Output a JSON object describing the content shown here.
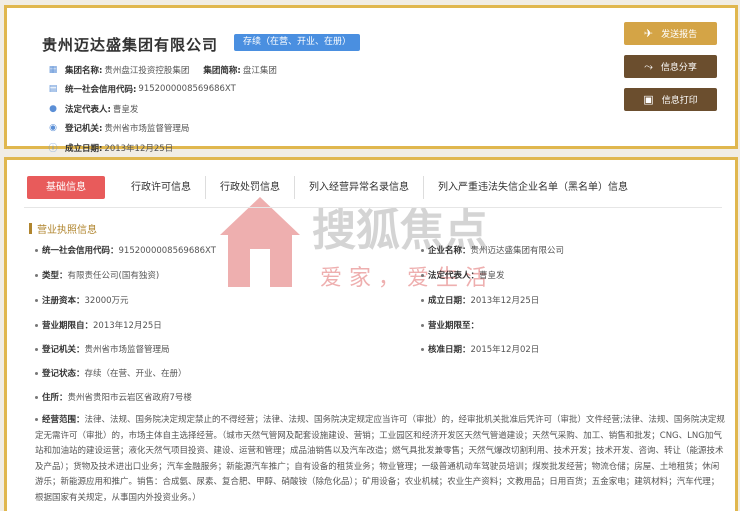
{
  "header": {
    "company_name": "贵州迈达盛集团有限公司",
    "status_tag": "存续（在营、开业、在册）",
    "lines": [
      {
        "icon": "building-icon",
        "label": "集团名称:",
        "value": "贵州盘江投资控股集团",
        "label2": "集团简称:",
        "value2": "盘江集团"
      },
      {
        "icon": "credit-code-icon",
        "label": "统一社会信用代码:",
        "value": "9152000008569686XT"
      },
      {
        "icon": "person-icon",
        "label": "法定代表人:",
        "value": "曹皇发"
      },
      {
        "icon": "location-pin-icon",
        "label": "登记机关:",
        "value": "贵州省市场监督管理局"
      },
      {
        "icon": "info-circle-icon",
        "label": "成立日期:",
        "value": "2013年12月25日"
      }
    ]
  },
  "actions": {
    "report": {
      "label": "发送报告",
      "icon": "send-icon"
    },
    "share": {
      "label": "信息分享",
      "icon": "share-icon"
    },
    "print": {
      "label": "信息打印",
      "icon": "print-icon"
    }
  },
  "tabs": [
    {
      "label": "基础信息",
      "active": true
    },
    {
      "label": "行政许可信息"
    },
    {
      "label": "行政处罚信息"
    },
    {
      "label": "列入经营异常名录信息"
    },
    {
      "label": "列入严重违法失信企业名单（黑名单）信息"
    }
  ],
  "section": {
    "title": "营业执照信息",
    "credit_code_label": "统一社会信用代码：",
    "credit_code": "9152000008569686XT",
    "company_name_label": "企业名称：",
    "company_name": "贵州迈达盛集团有限公司",
    "type_label": "类型：",
    "type": "有限责任公司(国有独资)",
    "legal_rep_label": "法定代表人：",
    "legal_rep": "曹皇发",
    "capital_label": "注册资本：",
    "capital": "32000万元",
    "founded_label": "成立日期：",
    "founded": "2013年12月25日",
    "period_from_label": "营业期限自：",
    "period_from": "2013年12月25日",
    "period_to_label": "营业期限至：",
    "period_to": "",
    "authority_label": "登记机关：",
    "authority": "贵州省市场监督管理局",
    "approval_label": "核准日期：",
    "approval": "2015年12月02日",
    "status_label": "登记状态：",
    "status": "存续（在营、开业、在册）",
    "address_label": "住所：",
    "address": "贵州省贵阳市云岩区省政府7号楼",
    "scope_label": "经营范围：",
    "scope": "法律、法规、国务院决定规定禁止的不得经营；法律、法规、国务院决定规定应当许可（审批）的，经审批机关批准后凭许可（审批）文件经营;法律、法规、国务院决定规定无需许可（审批）的，市场主体自主选择经营。（城市天然气管网及配套设施建设、营销；工业园区和经济开发区天然气管道建设；天然气采购、加工、销售和批发；CNG、LNG加气站和加油站的建设运营；液化天然气项目投资、建设、运营和管理；成品油销售以及汽车改造；燃气具批发兼零售；天然气爆改切割利用、技术开发；技术开发、咨询、转让（能源技术及产品）；货物及技术进出口业务；汽车金融服务；新能源汽车推广；自有设备的租赁业务；物业管理；一级普通机动车驾驶员培训；煤炭批发经营；物流仓储；房屋、土地租赁；休闲游乐；新能源应用和推广。销售：合成氨、尿素、复合肥、甲醇、硝酸铵（除危化品）；矿用设备；农业机械；农业生产资料；文教用品；日用百货；五金家电；建筑材料；汽车代理；根据国家有关规定，从事国内外投资业务。）"
  },
  "watermark": {
    "brand": "搜狐焦点",
    "slogan": "爱 家 ， 爱 生 活",
    "colors": {
      "red": "#d94242",
      "gray": "#9a9a9a"
    }
  }
}
